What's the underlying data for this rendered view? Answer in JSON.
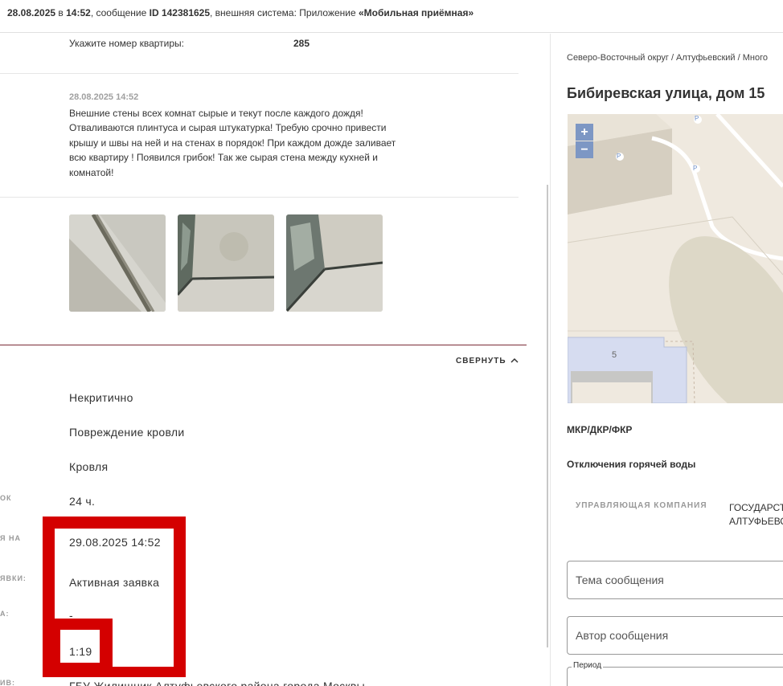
{
  "header": {
    "date": "28.08.2025",
    "in_word": "в",
    "time": "14:52",
    "msg_prefix": ", сообщение ",
    "msg_id": "ID 142381625",
    "system_prefix": ", внешняя система: Приложение ",
    "system_name": "«Мобильная приёмная»"
  },
  "apartment": {
    "label": "Укажите номер квартиры:",
    "value": "285"
  },
  "message": {
    "date": "28.08.2025 14:52",
    "text": "Внешние стены всех комнат сырые и текут после каждого дождя! Отваливаются плинтуса и сырая штукатурка! Требую срочно привести крышу и швы на ней и на стенах в порядок! При каждом дожде заливает всю квартиру ! Появился грибок! Так же сырая стена между кухней и комнатой!"
  },
  "photos": [
    "photo-1",
    "photo-2",
    "photo-3"
  ],
  "collapse_label": "СВЕРНУТЬ",
  "details": {
    "labels": [
      "ОК",
      "Я НА",
      "ЯВКИ:",
      "А:",
      "ИВ:"
    ],
    "values": [
      "Некритично",
      "Повреждение кровли",
      "Кровля",
      "24 ч.",
      "29.08.2025 14:52",
      "Активная заявка",
      "-",
      "1:19",
      "ГБУ Жилищник Алтуфьевского района города Москвы"
    ]
  },
  "right": {
    "breadcrumb": "Северо-Восточный округ / Алтуфьевский / Много",
    "address": "Бибиревская улица, дом 15",
    "map": {
      "zoom_in": "+",
      "zoom_out": "−",
      "house_number": "5",
      "parking": "P"
    },
    "mkr": "МКР/ДКР/ФКР",
    "hot_water": "Отключения горячей воды",
    "mgmt_label": "УПРАВЛЯЮЩАЯ КОМПАНИЯ",
    "mgmt_value_line1": "ГОСУДАРСТ",
    "mgmt_value_line2": "АЛТУФЬЕВС",
    "subject_placeholder": "Тема сообщения",
    "author_placeholder": "Автор сообщения",
    "period_label": "Период"
  },
  "colors": {
    "overlay": "#d40000",
    "divider": "#7a2b36",
    "zoom": "#7d97c4"
  }
}
